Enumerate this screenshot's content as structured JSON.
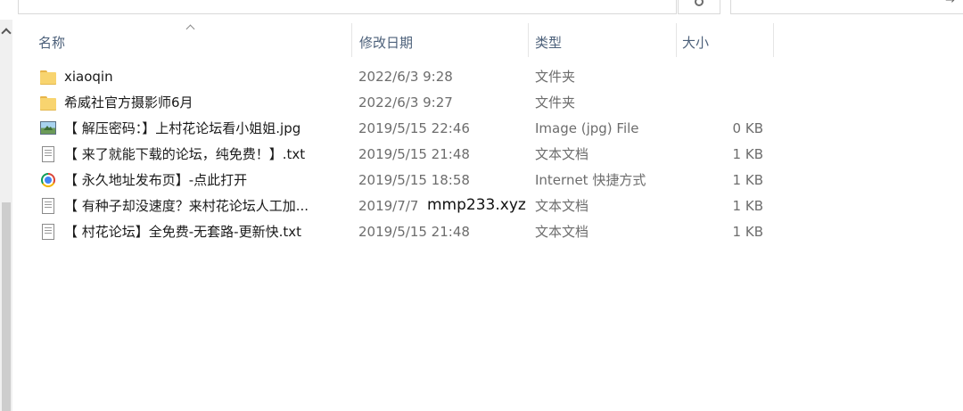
{
  "address_bar": {
    "text": ""
  },
  "search": {
    "placeholder": ""
  },
  "columns": {
    "name": "名称",
    "date": "修改日期",
    "type": "类型",
    "size": "大小"
  },
  "files": [
    {
      "name": "xiaoqin",
      "date": "2022/6/3 9:28",
      "type": "文件夹",
      "size": "",
      "icon": "folder-icon"
    },
    {
      "name": "希威社官方摄影师6月",
      "date": "2022/6/3 9:27",
      "type": "文件夹",
      "size": "",
      "icon": "folder-icon"
    },
    {
      "name": "【 解压密码：】上村花论坛看小姐姐.jpg",
      "date": "2019/5/15 22:46",
      "type": "Image (jpg) File",
      "size": "0 KB",
      "icon": "image-file-icon"
    },
    {
      "name": "【 来了就能下载的论坛，纯免费！】.txt",
      "date": "2019/5/15 21:48",
      "type": "文本文档",
      "size": "1 KB",
      "icon": "text-file-icon"
    },
    {
      "name": "【 永久地址发布页】-点此打开",
      "date": "2019/5/15 18:58",
      "type": "Internet 快捷方式",
      "size": "1 KB",
      "icon": "internet-shortcut-icon"
    },
    {
      "name": "【 有种子却没速度？来村花论坛人工加...",
      "date": "2019/7/7 ",
      "type": "文本文档",
      "size": "1 KB",
      "icon": "text-file-icon"
    },
    {
      "name": "【 村花论坛】全免费-无套路-更新快.txt",
      "date": "2019/5/15 21:48",
      "type": "文本文档",
      "size": "1 KB",
      "icon": "text-file-icon"
    }
  ],
  "watermark": "mmp233.xyz",
  "colors": {
    "header_text": "#4c607a",
    "meta_text": "#6d6d6d",
    "folder": "#f8d46f"
  }
}
